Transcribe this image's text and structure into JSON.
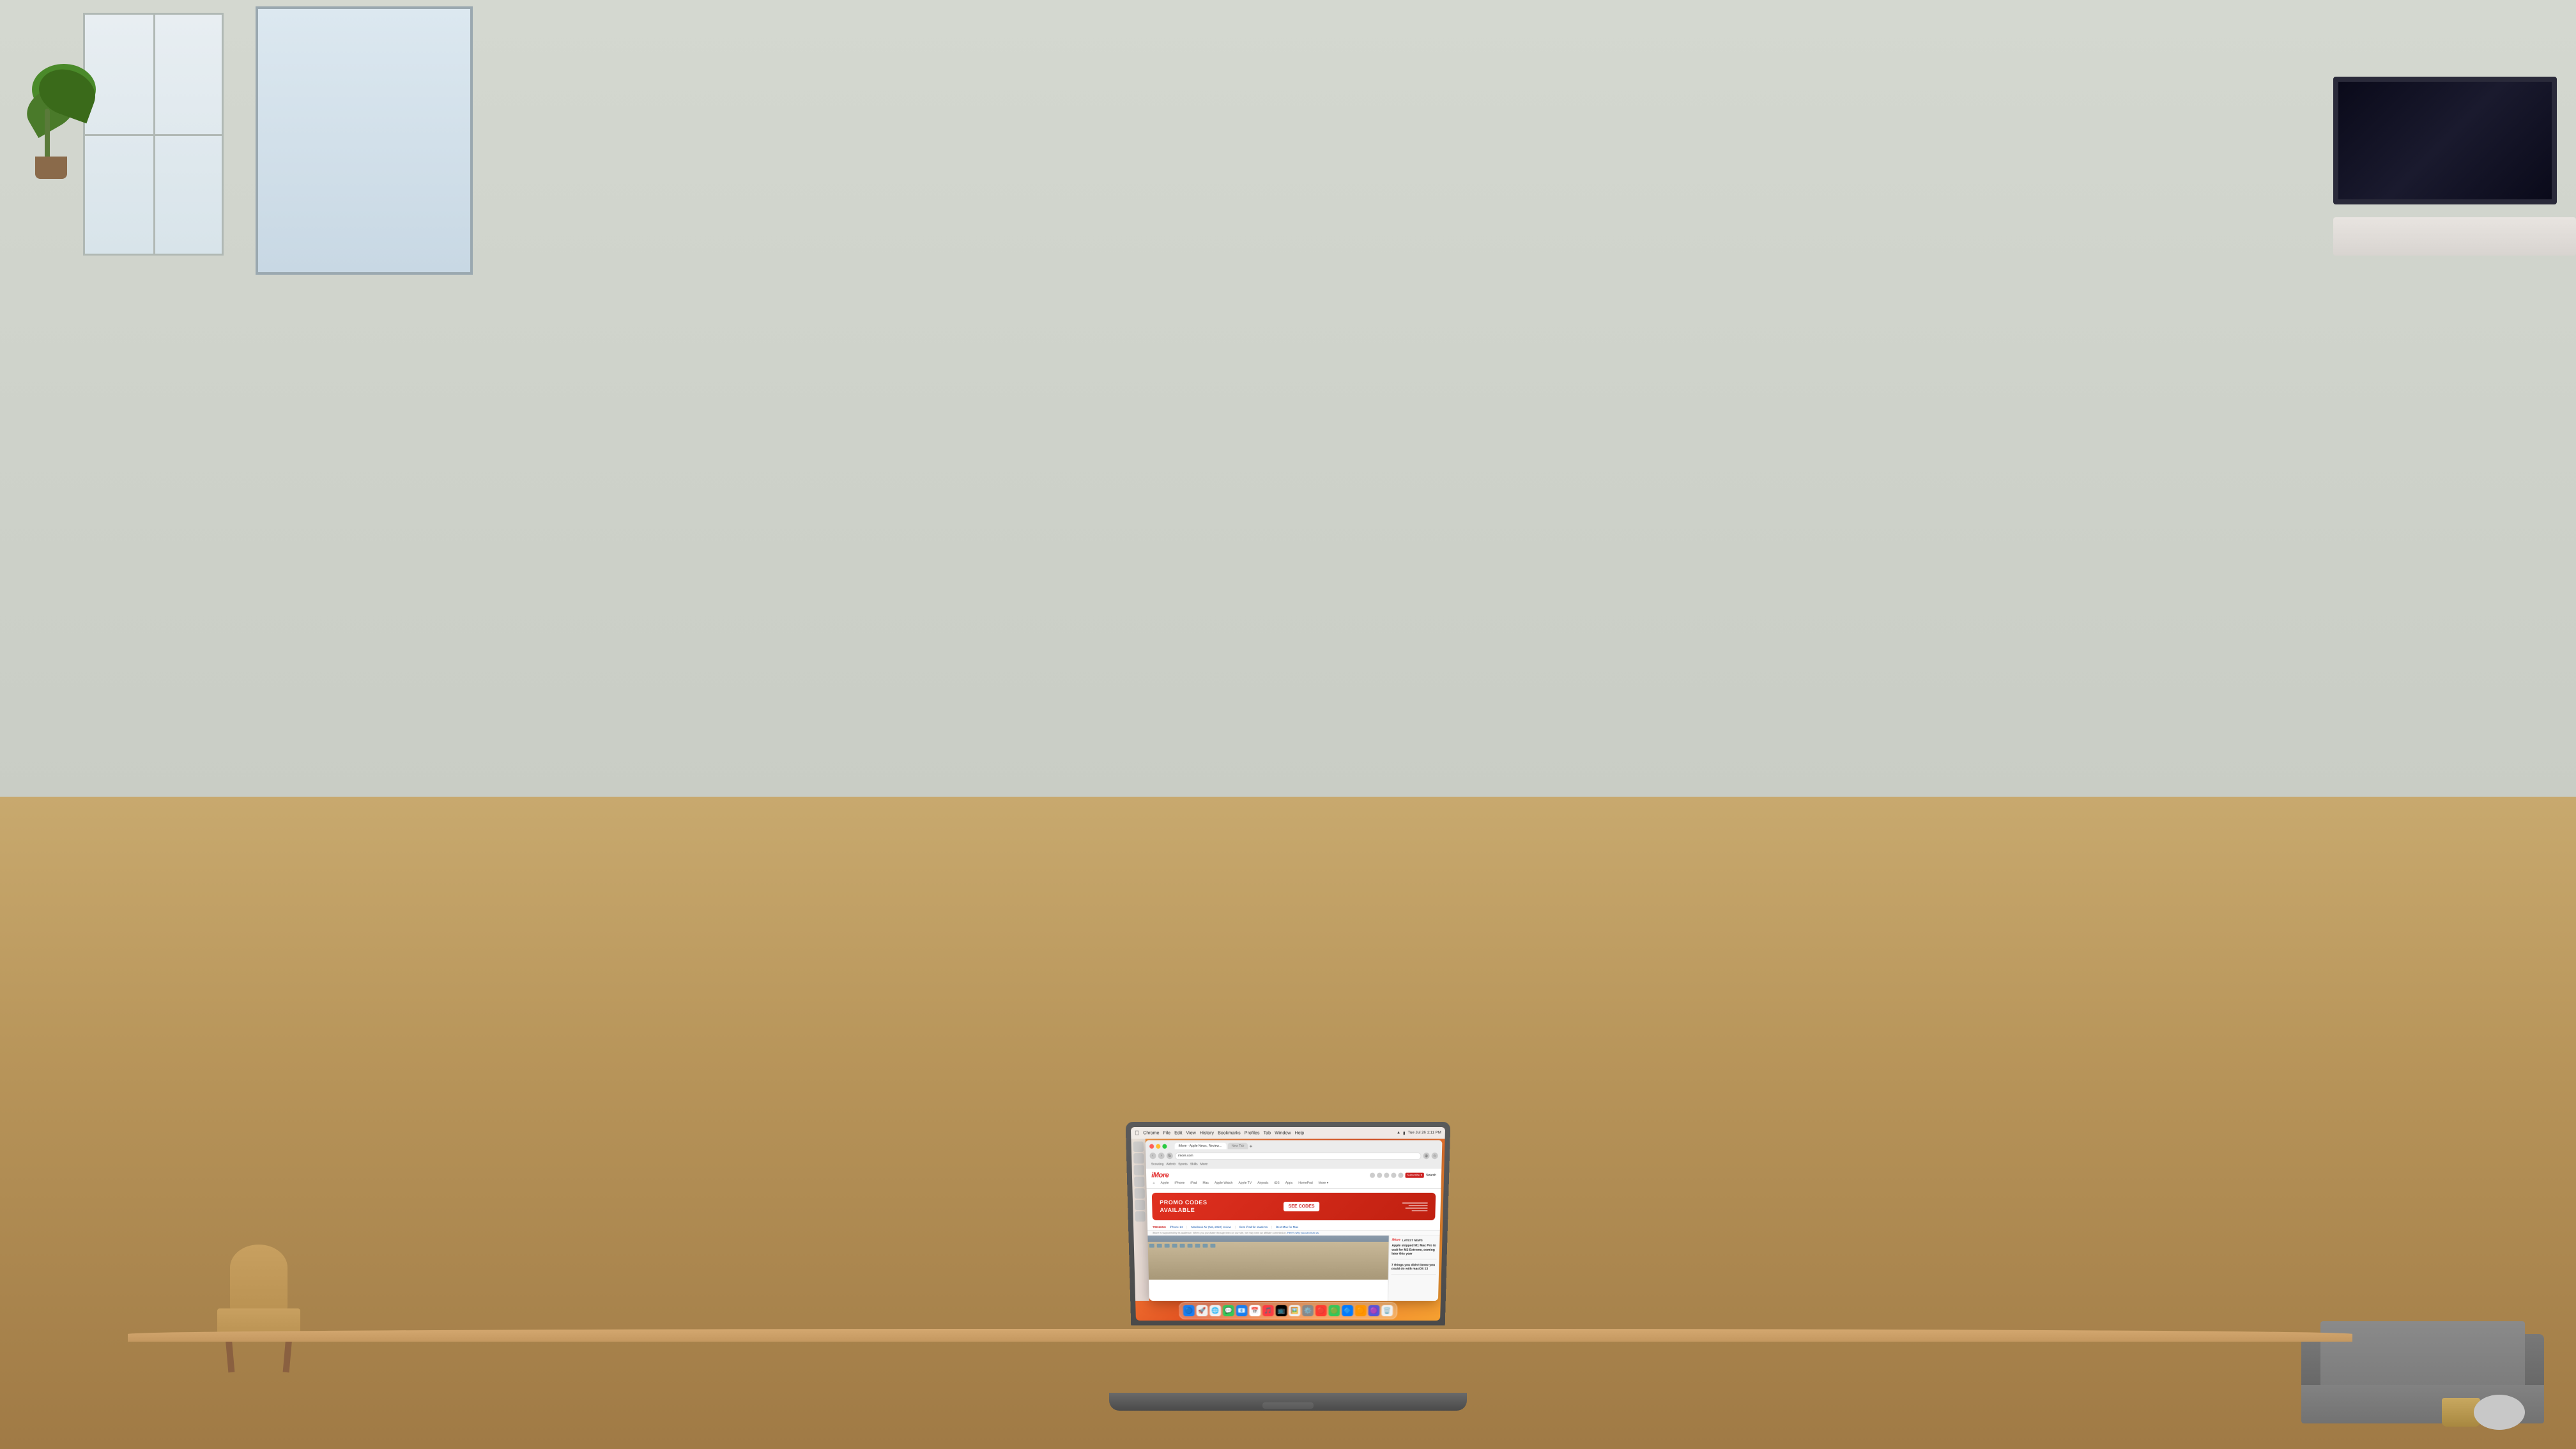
{
  "scene": {
    "description": "MacBook Pro on wooden table in living room"
  },
  "browser": {
    "title": "Chrome",
    "tab_active": "iMore - Apple News, Reviews, ...",
    "tab_inactive": "New Tab",
    "url": "imore.com",
    "url_display": "imore.com",
    "bookmarks": [
      "Scouting",
      "Airbnb",
      "Sports",
      "Skills",
      "More"
    ]
  },
  "website": {
    "name": "iMore",
    "logo": "iMore",
    "nav_items": [
      "⌂",
      "Apple",
      "iPhone",
      "iPad",
      "Mac",
      "Apple Watch",
      "Apple TV",
      "Airpods",
      "iOS",
      "Apps",
      "HomePod",
      "More ▾"
    ],
    "subnav_subscribe": "Subscribe ▾",
    "subnav_search": "Search",
    "promo": {
      "title": "PROMO CODES",
      "subtitle": "AVAILABLE",
      "cta": "SEE CODES"
    },
    "trending_label": "TRENDING",
    "trending_items": [
      "iPhone 14",
      "MacBook Air (M2, 2022) review",
      "Best iPad for students",
      "Best Mac for Mac"
    ],
    "affiliate_text": "iMore is supported by its audience. When you purchase through links on our site, we may earn an affiliate commission.",
    "latest_news_label": "LATEST NEWS",
    "news_items": [
      {
        "title": "Apple skipped M1 Mac Pro to wait for M2 Extreme, coming later this year"
      },
      {
        "title": "7 things you didn't know you could do with macOS 13"
      }
    ]
  },
  "mac": {
    "menubar": {
      "apple": "⌘",
      "items": [
        "Chrome",
        "File",
        "Edit",
        "View",
        "History",
        "Bookmarks",
        "Profiles",
        "Tab",
        "Window",
        "Help"
      ],
      "time": "Tue Jul 26 1:11 PM"
    },
    "dock_icons": [
      "🔵",
      "📁",
      "🌐",
      "📱",
      "📧",
      "📅",
      "🎵",
      "🎬",
      "⚙️",
      "🔴",
      "🟢",
      "🔷",
      "🟠"
    ]
  }
}
